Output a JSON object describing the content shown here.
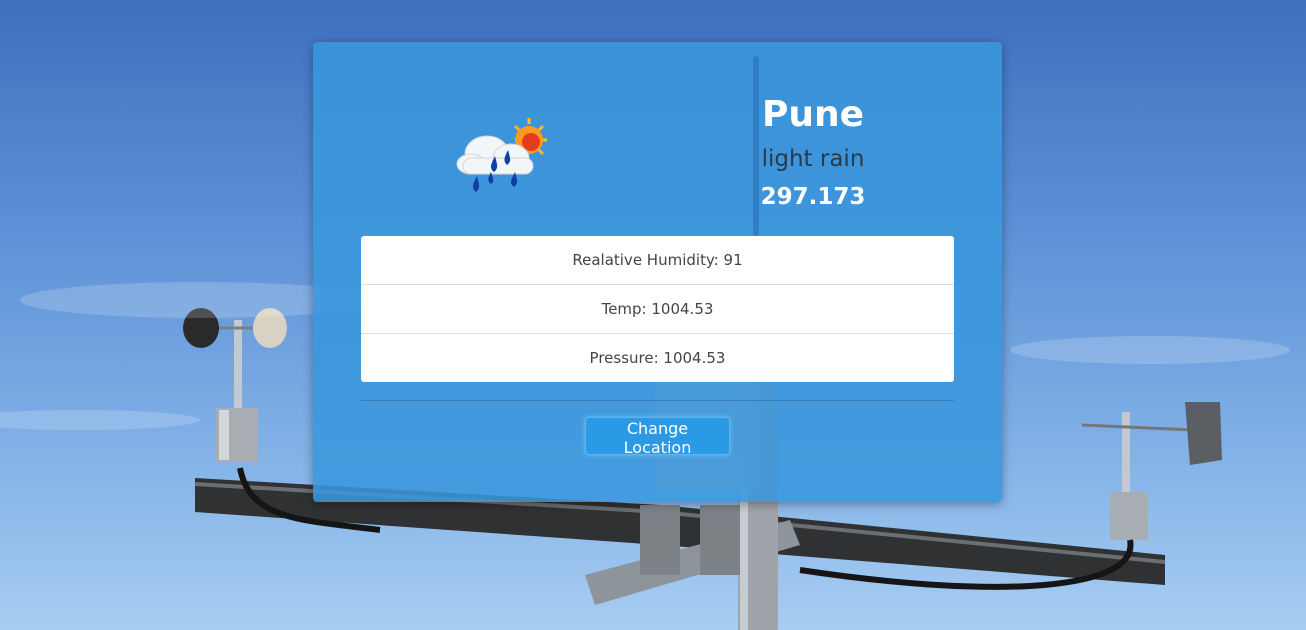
{
  "weather": {
    "icon": "light-rain-cloud-sun-icon",
    "city": "Pune",
    "description": "light rain",
    "temperature": "297.173"
  },
  "details": [
    {
      "label": "Realative Humidity: 91"
    },
    {
      "label": "Temp: 1004.53"
    },
    {
      "label": "Pressure: 1004.53"
    }
  ],
  "actions": {
    "change_location_label": "Change Location"
  },
  "colors": {
    "card_bg": "#3a96dc",
    "button_bg": "#2a9ae6"
  }
}
